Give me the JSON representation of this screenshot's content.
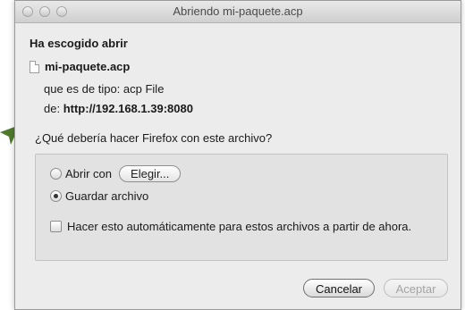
{
  "window": {
    "title": "Abriendo mi-paquete.acp"
  },
  "dialog": {
    "heading": "Ha escogido abrir",
    "file_name": "mi-paquete.acp",
    "type_line": "que es de tipo:  acp File",
    "from_prefix": "de:",
    "from_url": "http://192.168.1.39:8080",
    "question": "¿Qué debería hacer Firefox con este archivo?"
  },
  "options": {
    "open_with_label": "Abrir con",
    "choose_button": "Elegir...",
    "save_label": "Guardar archivo",
    "selected": "save",
    "auto_label": "Hacer esto automáticamente para estos archivos a partir de ahora.",
    "auto_checked": false
  },
  "buttons": {
    "cancel": "Cancelar",
    "accept": "Aceptar",
    "accept_enabled": false
  },
  "colors": {
    "arrow": "#4f7a2a"
  }
}
